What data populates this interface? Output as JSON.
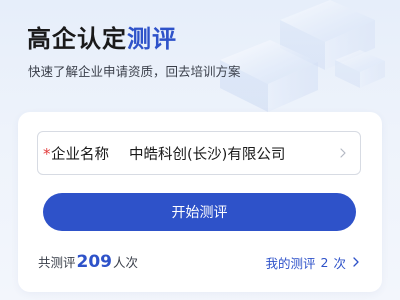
{
  "header": {
    "title_main": "高企认定",
    "title_accent": "测评",
    "subtitle": "快速了解企业申请资质，回去培训方案"
  },
  "form": {
    "company_field": {
      "required_mark": "*",
      "label": "企业名称",
      "value": "中皓科创(长沙)有限公司"
    },
    "start_button_label": "开始测评"
  },
  "stats": {
    "prefix": "共测评",
    "count": "209",
    "suffix": "人次"
  },
  "my_evaluations": {
    "prefix": "我的测评",
    "count": "2",
    "suffix": "次"
  },
  "colors": {
    "accent": "#2e52c9",
    "required": "#e23b3b",
    "background": "#eef3fb"
  },
  "icons": {
    "field_arrow": "chevron-right-icon",
    "link_arrow": "chevron-right-icon",
    "decoration": "stacked-glass-cubes"
  }
}
